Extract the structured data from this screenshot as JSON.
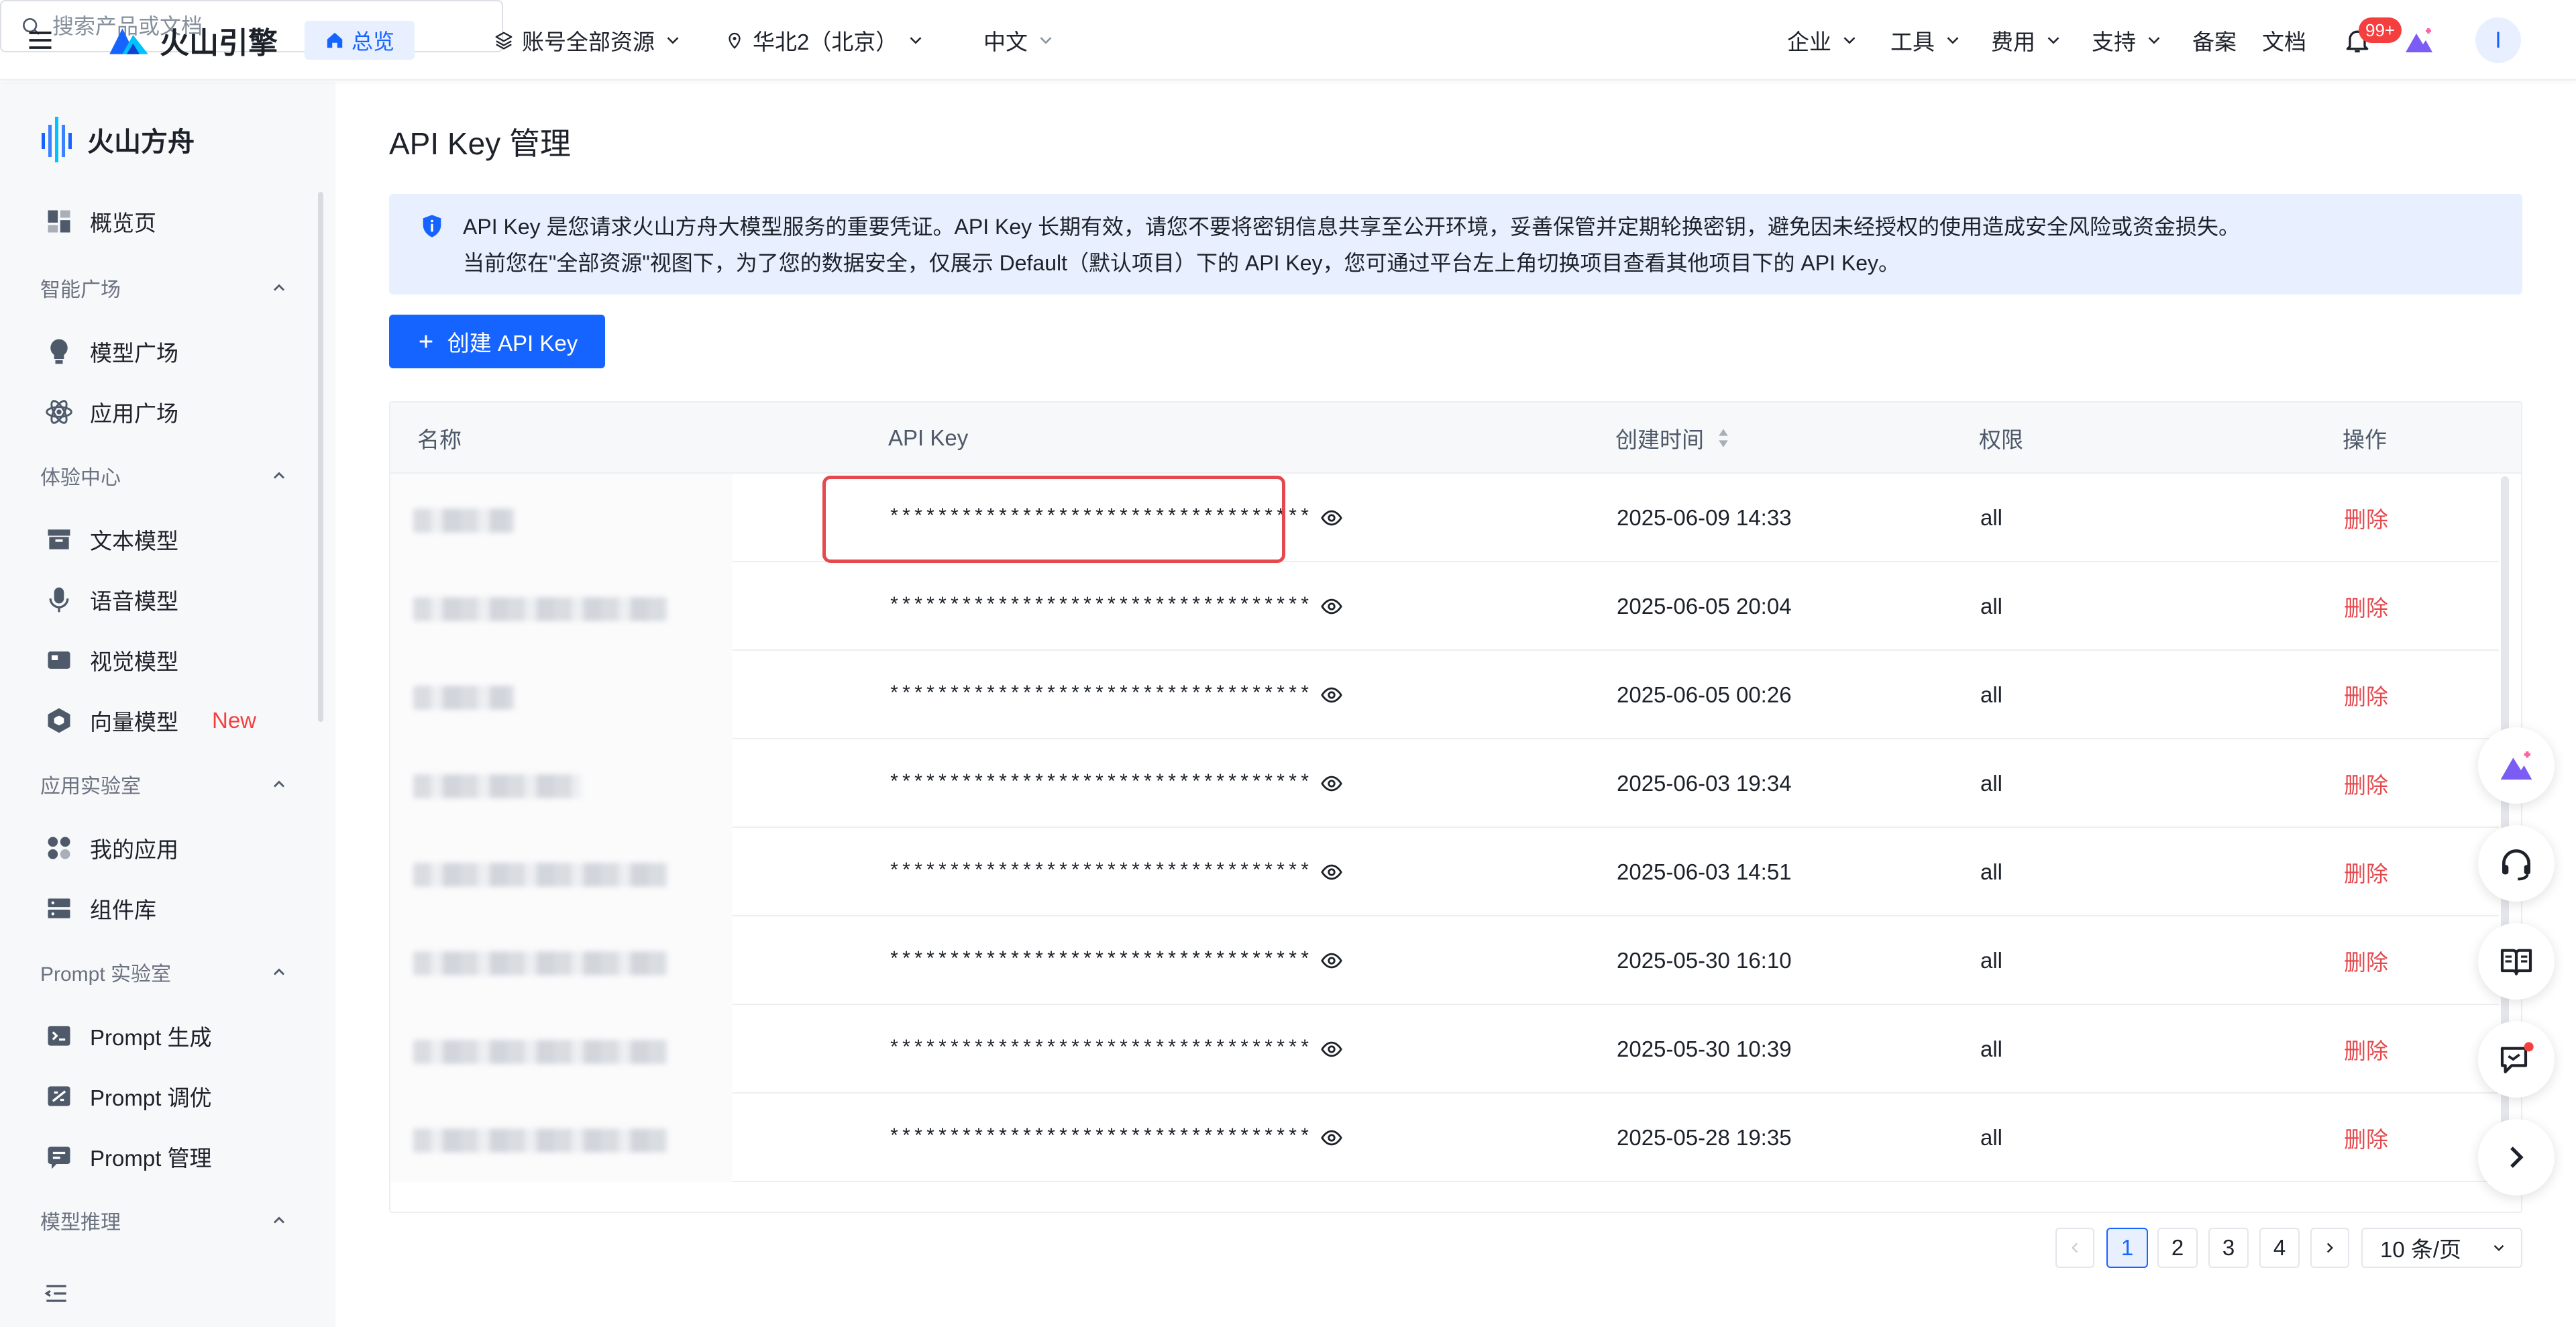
{
  "topbar": {
    "brand": "火山引擎",
    "home_label": "总览",
    "resources_label": "账号全部资源",
    "region_label": "华北2（北京）",
    "language_label": "中文",
    "search_placeholder": "搜索产品或文档",
    "nav": [
      "企业",
      "工具",
      "费用",
      "支持"
    ],
    "filing_label": "备案",
    "docs_label": "文档",
    "notification_badge": "99+",
    "avatar_initial": "I"
  },
  "sidebar": {
    "brand": "火山方舟",
    "overview": "概览页",
    "groups": [
      {
        "title": "智能广场",
        "items": [
          "模型广场",
          "应用广场"
        ]
      },
      {
        "title": "体验中心",
        "items": [
          "文本模型",
          "语音模型",
          "视觉模型",
          "向量模型"
        ]
      },
      {
        "title": "应用实验室",
        "items": [
          "我的应用",
          "组件库"
        ]
      },
      {
        "title": "Prompt 实验室",
        "items": [
          "Prompt 生成",
          "Prompt 调优",
          "Prompt 管理"
        ]
      },
      {
        "title": "模型推理",
        "items": []
      }
    ],
    "new_tag": "New"
  },
  "page": {
    "title": "API Key 管理",
    "notice_line1": "API Key 是您请求火山方舟大模型服务的重要凭证。API Key 长期有效，请您不要将密钥信息共享至公开环境，妥善保管并定期轮换密钥，避免因未经授权的使用造成安全风险或资金损失。",
    "notice_line2": "当前您在\"全部资源\"视图下，为了您的数据安全，仅展示 Default（默认项目）下的 API Key，您可通过平台左上角切换项目查看其他项目下的 API Key。",
    "create_button": "创建 API Key"
  },
  "table": {
    "columns": [
      "名称",
      "API Key",
      "创建时间",
      "权限",
      "操作"
    ],
    "masked_key": "***********************************",
    "delete_label": "删除",
    "rows": [
      {
        "created": "2025-06-09 14:33",
        "permission": "all"
      },
      {
        "created": "2025-06-05 20:04",
        "permission": "all"
      },
      {
        "created": "2025-06-05 00:26",
        "permission": "all"
      },
      {
        "created": "2025-06-03 19:34",
        "permission": "all"
      },
      {
        "created": "2025-06-03 14:51",
        "permission": "all"
      },
      {
        "created": "2025-05-30 16:10",
        "permission": "all"
      },
      {
        "created": "2025-05-30 10:39",
        "permission": "all"
      },
      {
        "created": "2025-05-28 19:35",
        "permission": "all"
      }
    ]
  },
  "pagination": {
    "pages": [
      "1",
      "2",
      "3",
      "4"
    ],
    "current": "1",
    "page_size": "10 条/页"
  }
}
